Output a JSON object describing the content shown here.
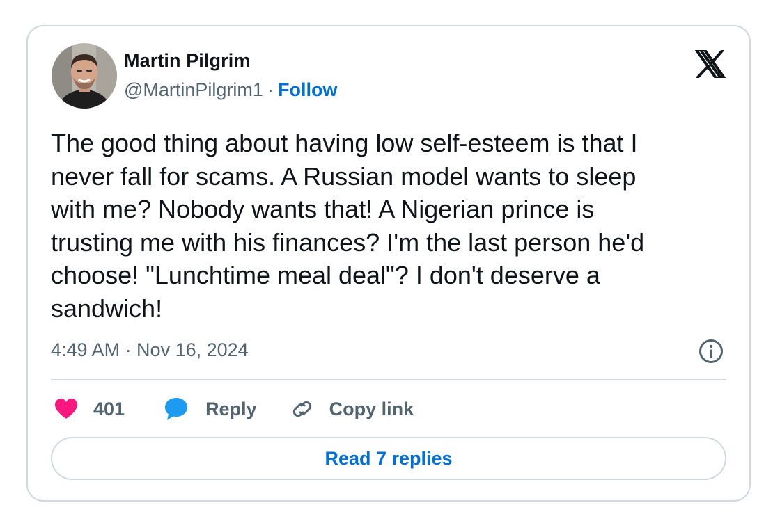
{
  "author": {
    "name": "Martin Pilgrim",
    "handle": "@MartinPilgrim1",
    "separator": "·",
    "follow_label": "Follow"
  },
  "tweet": {
    "text": "The good thing about having low self-esteem is that I\nnever fall for scams. A Russian model wants to sleep\nwith me? Nobody wants that! A Nigerian prince is\ntrusting me with his finances? I'm the last person he'd\nchoose! \"Lunchtime meal deal\"? I don't deserve a\nsandwich!",
    "timestamp": "4:49 AM · Nov 16, 2024"
  },
  "actions": {
    "like_count": "401",
    "reply_label": "Reply",
    "copy_link_label": "Copy link"
  },
  "read_replies_label": "Read 7 replies",
  "icons": {
    "logo": "x-logo-icon",
    "info": "info-icon",
    "like": "heart-icon",
    "reply": "speech-bubble-icon",
    "copy": "link-icon"
  },
  "colors": {
    "accent_blue": "#006fd6",
    "heart_pink": "#f91880",
    "reply_blue": "#1d9bf0",
    "text_primary": "#0f1419",
    "text_secondary": "#536471",
    "border": "#cfd9de"
  }
}
